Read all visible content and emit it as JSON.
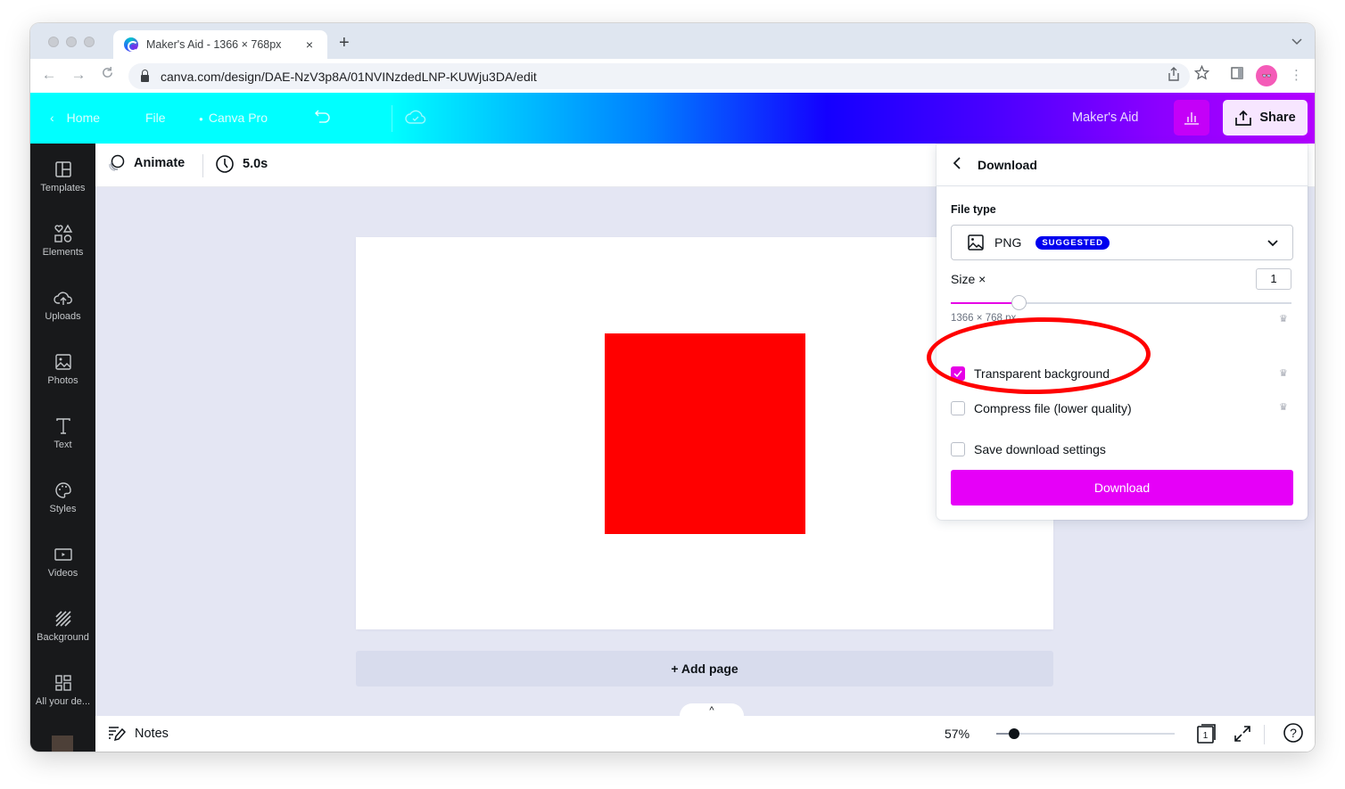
{
  "browser": {
    "tab_title": "Maker's Aid - 1366 × 768px",
    "tab_close": "×",
    "new_tab": "+",
    "tab_list_icon": "chevron-down-icon",
    "back": "←",
    "forward": "→",
    "reload": "C",
    "url": "canva.com/design/DAE-NzV3p8A/01NVINzdedLNP-KUWju3DA/edit",
    "profile_glyph": "👓",
    "menu_glyph": "⋮"
  },
  "header": {
    "home": "Home",
    "file": "File",
    "canva_pro": "Canva Pro",
    "design_title": "Maker's Aid",
    "share": "Share"
  },
  "sidebar": {
    "items": [
      {
        "label": "Templates",
        "icon": "templates-icon"
      },
      {
        "label": "Elements",
        "icon": "elements-icon"
      },
      {
        "label": "Uploads",
        "icon": "upload-cloud-icon"
      },
      {
        "label": "Photos",
        "icon": "photo-icon"
      },
      {
        "label": "Text",
        "icon": "text-icon"
      },
      {
        "label": "Styles",
        "icon": "palette-icon"
      },
      {
        "label": "Videos",
        "icon": "video-icon"
      },
      {
        "label": "Background",
        "icon": "background-icon"
      },
      {
        "label": "All your de...",
        "icon": "grid-icon"
      }
    ]
  },
  "context_toolbar": {
    "animate": "Animate",
    "duration": "5.0s"
  },
  "editor": {
    "add_page": "+ Add page",
    "pager_toggle": "^",
    "shape_color": "#ff0000"
  },
  "bottombar": {
    "notes": "Notes",
    "zoom_percent": "57%",
    "zoom_slider_fraction": 0.1,
    "page_count": "1",
    "help": "?"
  },
  "download_panel": {
    "title": "Download",
    "file_type_label": "File type",
    "file_type": "PNG",
    "file_type_badge": "SUGGESTED",
    "size_label": "Size ×",
    "size_value": "1",
    "size_slider_fraction": 0.2,
    "dimensions": "1366 × 768 px",
    "options": [
      {
        "label": "Transparent background",
        "checked": true,
        "pro": true
      },
      {
        "label": "Compress file (lower quality)",
        "checked": false,
        "pro": true
      },
      {
        "label": "Save download settings",
        "checked": false,
        "pro": false
      }
    ],
    "download_button": "Download",
    "accent_color": "#e600f8",
    "badge_color": "#0000ee"
  },
  "annotation": {
    "highlight_color": "#ff0000",
    "highlights": "Transparent background"
  }
}
